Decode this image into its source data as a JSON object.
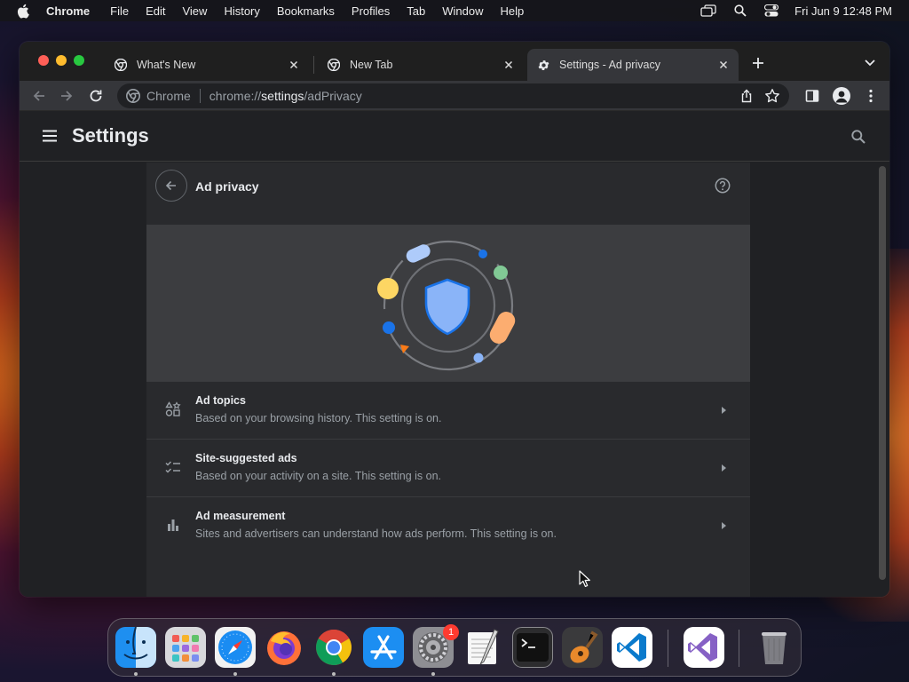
{
  "menubar": {
    "app_name": "Chrome",
    "items": [
      "File",
      "Edit",
      "View",
      "History",
      "Bookmarks",
      "Profiles",
      "Tab",
      "Window",
      "Help"
    ],
    "clock": "Fri Jun 9  12:48 PM"
  },
  "tabs": [
    {
      "title": "What's New",
      "active": false
    },
    {
      "title": "New Tab",
      "active": false
    },
    {
      "title": "Settings - Ad privacy",
      "active": true
    }
  ],
  "omnibox": {
    "site_chip": "Chrome",
    "url_scheme": "chrome://",
    "url_host": "settings",
    "url_path": "/adPrivacy"
  },
  "settings": {
    "title": "Settings",
    "page_heading": "Ad privacy",
    "rows": [
      {
        "title": "Ad topics",
        "subtitle": "Based on your browsing history. This setting is on.",
        "icon": "ad-topics-icon"
      },
      {
        "title": "Site-suggested ads",
        "subtitle": "Based on your activity on a site. This setting is on.",
        "icon": "checklist-icon"
      },
      {
        "title": "Ad measurement",
        "subtitle": "Sites and advertisers can understand how ads perform. This setting is on.",
        "icon": "bar-chart-icon"
      }
    ]
  },
  "dock": {
    "apps": [
      "Finder",
      "Launchpad",
      "Safari",
      "Firefox",
      "Google Chrome",
      "App Store",
      "System Settings",
      "TextEdit",
      "Terminal",
      "GarageBand",
      "Visual Studio Code",
      "Visual Studio",
      "Trash"
    ],
    "system_settings_badge": "1"
  },
  "colors": {
    "window_bg": "#202124",
    "card_bg": "#292a2d",
    "banner_bg": "#3c3d40",
    "accent_blue": "#8ab4f8"
  }
}
